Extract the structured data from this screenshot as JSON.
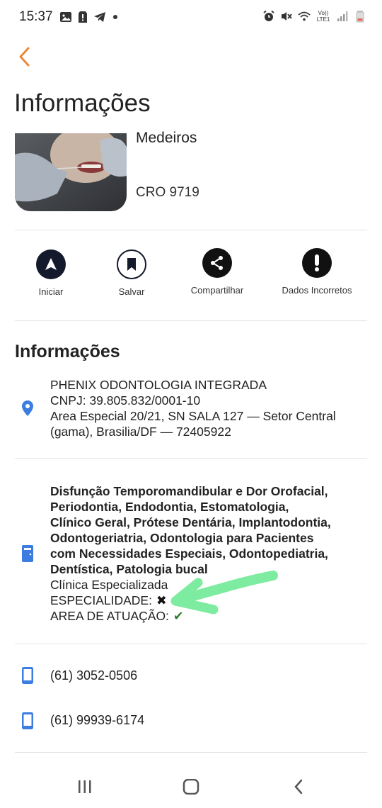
{
  "status_bar": {
    "time": "15:37",
    "left_icons": [
      "gallery-icon",
      "alert-icon",
      "telegram-icon",
      "dot-icon"
    ],
    "right_icons": [
      "alarm-icon",
      "mute-icon",
      "wifi-icon",
      "volte-icon",
      "signal-icon",
      "battery-icon"
    ],
    "volte_label": "Vo)) LTE1"
  },
  "header": {
    "back_icon": "chevron-left-icon",
    "title": "Informações",
    "accent_color": "#e8893a"
  },
  "profile": {
    "name": "Medeiros",
    "cro": "CRO 9719",
    "photo_icon": "dentist-photo"
  },
  "actions": [
    {
      "label": "Iniciar",
      "icon": "navigation-icon"
    },
    {
      "label": "Salvar",
      "icon": "bookmark-icon"
    },
    {
      "label": "Compartilhar",
      "icon": "share-icon"
    },
    {
      "label": "Dados Incorretos",
      "icon": "exclamation-icon"
    }
  ],
  "info": {
    "section_title": "Informações",
    "address": {
      "icon": "location-pin-icon",
      "company": "PHENIX ODONTOLOGIA INTEGRADA",
      "cnpj": "CNPJ: 39.805.832/0001-10",
      "street": "Area Especial 20/21, SN SALA 127 — Setor Central",
      "city": "(gama), Brasilia/DF — 72405922"
    },
    "specialties": {
      "icon": "door-icon",
      "lines": [
        "Disfunção Temporomandibular e Dor Orofacial,",
        "Periodontia, Endodontia, Estomatologia,",
        "Clínico Geral, Prótese Dentária, Implantodontia,",
        "Odontogeriatria, Odontologia para Pacientes",
        "com Necessidades Especiais, Odontopediatria,",
        "Dentística, Patologia bucal"
      ],
      "type": "Clínica Especializada",
      "especialidade_label": "ESPECIALIDADE:",
      "especialidade_mark": "✖",
      "atuacao_label": "AREA DE ATUAÇÃO:",
      "atuacao_mark": "✔"
    },
    "phones": [
      {
        "icon": "phone-icon",
        "number": "(61) 3052-0506"
      },
      {
        "icon": "phone-icon",
        "number": "(61) 99939-6174"
      }
    ],
    "icon_color": "#3b7de0"
  },
  "annotation": {
    "arrow_color": "#7deca0"
  },
  "nav_bar": {
    "icons": [
      "recents-icon",
      "home-icon",
      "back-icon"
    ]
  }
}
